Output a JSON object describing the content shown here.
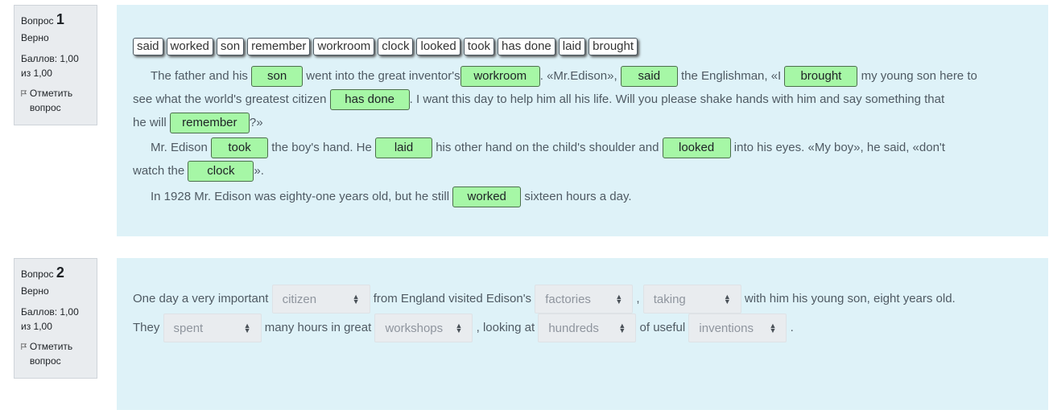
{
  "q1": {
    "info": {
      "label": "Вопрос",
      "number": "1",
      "status": "Верно",
      "grade": "Баллов: 1,00 из 1,00",
      "flag": "Отметить вопрос"
    },
    "drag_items": [
      "said",
      "worked",
      "son",
      "remember",
      "workroom",
      "clock",
      "looked",
      "took",
      "has done",
      "laid",
      "brought"
    ],
    "p1": {
      "t1": "The father and his",
      "d1": "son",
      "t2": "went into the great inventor's",
      "d2": "workroom",
      "t3": ". «Mr.Edison»,",
      "d3": "said",
      "t4": "the Englishman, «I",
      "d4": "brought",
      "t5": "my young son here to",
      "t6": "see what the world's greatest citizen",
      "d5": "has done",
      "t7": ". I want this day to help him all his life. Will you please shake hands with him and say something that",
      "t8": "he will",
      "d6": "remember",
      "t9": "?»"
    },
    "p2": {
      "t1": "Mr. Edison",
      "d1": "took",
      "t2": "the boy's hand. He",
      "d2": "laid",
      "t3": "his other hand on the child's shoulder and",
      "d3": "looked",
      "t4": "into his eyes. «My boy», he said, «don't",
      "t5": "watch the",
      "d4": "clock",
      "t6": "»."
    },
    "p3": {
      "t1": "In 1928 Mr. Edison was eighty-one years old, but he still",
      "d1": "worked",
      "t2": "sixteen hours a day."
    }
  },
  "q2": {
    "info": {
      "label": "Вопрос",
      "number": "2",
      "status": "Верно",
      "grade": "Баллов: 1,00 из 1,00",
      "flag": "Отметить вопрос"
    },
    "l1": {
      "t1": "One day a very important",
      "s1": "citizen",
      "t2": "from England visited Edison's",
      "s2": "factories",
      "t3": ",",
      "s3": "taking",
      "t4": "with him his young son, eight years old."
    },
    "l2": {
      "t1": "They",
      "s1": "spent",
      "t2": "many hours in great",
      "s2": "workshops",
      "t3": ", looking at",
      "s3": "hundreds",
      "t4": "of useful",
      "s4": "inventions",
      "t5": "."
    }
  }
}
